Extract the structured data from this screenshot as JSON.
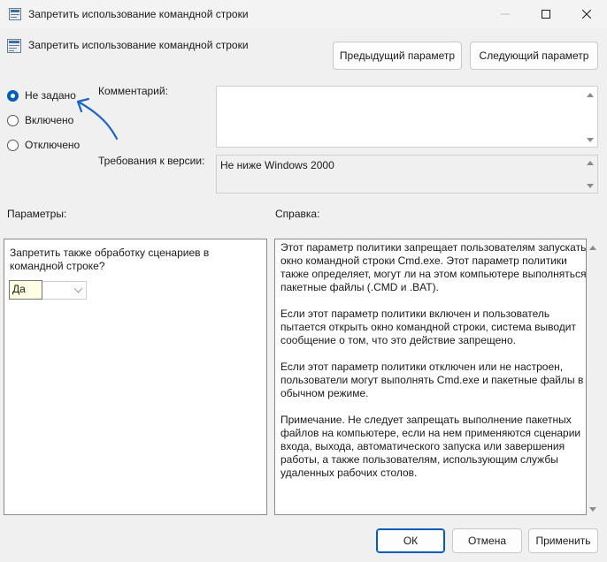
{
  "window": {
    "title": "Запретить использование командной строки"
  },
  "header": {
    "policy_name": "Запретить использование командной строки",
    "prev_button": "Предыдущий параметр",
    "next_button": "Следующий параметр"
  },
  "state": {
    "options": [
      {
        "label": "Не задано",
        "checked": true
      },
      {
        "label": "Включено",
        "checked": false
      },
      {
        "label": "Отключено",
        "checked": false
      }
    ]
  },
  "comment": {
    "label": "Комментарий:",
    "value": ""
  },
  "requirements": {
    "label": "Требования к версии:",
    "value": "Не ниже Windows 2000"
  },
  "parameters": {
    "heading": "Параметры:",
    "option_text": "Запретить также обработку сценариев в командной строке?",
    "dropdown_value": "Да"
  },
  "help": {
    "heading": "Справка:",
    "paragraphs": [
      "Этот параметр политики запрещает пользователям запускать окно командной строки Cmd.exe.  Этот параметр политики также определяет, могут ли на этом компьютере выполняться пакетные файлы (.CMD и .BAT).",
      "Если этот параметр политики включен и пользователь пытается открыть окно командной строки, система выводит сообщение о том, что это действие запрещено.",
      "Если этот параметр политики отключен или не настроен, пользователи могут выполнять Cmd.exe и пакетные файлы в обычном режиме.",
      "Примечание. Не следует запрещать выполнение пакетных файлов на компьютере, если на нем применяются сценарии входа, выхода, автоматического запуска или завершения работы, а также пользователям, использующим службы удаленных рабочих столов."
    ]
  },
  "footer": {
    "ok_button": "ОК",
    "cancel_button": "Отмена",
    "apply_button": "Применить"
  },
  "colors": {
    "accent": "#005fb8",
    "annotation_arrow": "#1e64c8",
    "window_bg": "#f0f0f0"
  }
}
